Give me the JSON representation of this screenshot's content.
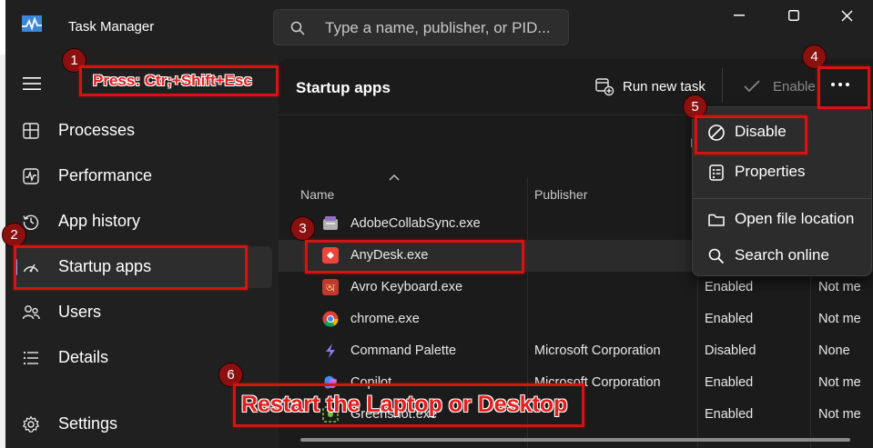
{
  "window": {
    "title": "Task Manager",
    "search_placeholder": "Type a name, publisher, or PID..."
  },
  "sidebar": {
    "items": [
      {
        "label": "Processes",
        "icon": "processes-icon"
      },
      {
        "label": "Performance",
        "icon": "performance-icon"
      },
      {
        "label": "App history",
        "icon": "history-icon"
      },
      {
        "label": "Startup apps",
        "icon": "startup-speedometer-icon",
        "active": true
      },
      {
        "label": "Users",
        "icon": "users-icon"
      },
      {
        "label": "Details",
        "icon": "details-list-icon"
      }
    ],
    "settings_label": "Settings"
  },
  "main": {
    "title": "Startup apps",
    "toolbar": {
      "run_new_task": "Run new task",
      "enable": "Enable"
    },
    "faint_letter": "L",
    "columns": [
      "Name",
      "Publisher"
    ],
    "rows": [
      {
        "name": "AdobeCollabSync.exe",
        "publisher": "",
        "status": "",
        "impact": "",
        "icon_color": "#c8c8c8"
      },
      {
        "name": "AnyDesk.exe",
        "publisher": "",
        "status": "",
        "impact": "",
        "icon_color": "#ef443b",
        "selected": true
      },
      {
        "name": "Avro Keyboard.exe",
        "publisher": "",
        "status": "Enabled",
        "impact": "Not me",
        "icon_color": "#d9534f"
      },
      {
        "name": "chrome.exe",
        "publisher": "",
        "status": "Enabled",
        "impact": "Not me",
        "icon_color": "#34a853"
      },
      {
        "name": "Command Palette",
        "publisher": "Microsoft Corporation",
        "status": "Disabled",
        "impact": "None",
        "icon_color": "#7c6cf0"
      },
      {
        "name": "Copilot",
        "publisher": "Microsoft Corporation",
        "status": "Enabled",
        "impact": "Not me",
        "icon_color": "#5aa0ff"
      },
      {
        "name": "Greenshot.exe",
        "publisher": "",
        "status": "Enabled",
        "impact": "Not me",
        "icon_color": "#6fbf3b"
      }
    ]
  },
  "context_menu": {
    "items": [
      "Disable",
      "Properties",
      "Open file location",
      "Search online"
    ]
  },
  "annotations": {
    "steps": [
      "1",
      "2",
      "3",
      "4",
      "5",
      "6"
    ],
    "note_shortcut": "Press: Ctr;+Shift+Esc",
    "note_restart": "Restart the Laptop or Desktop"
  },
  "colors": {
    "accent": "#4cc2ff",
    "highlight": "#d41414"
  }
}
